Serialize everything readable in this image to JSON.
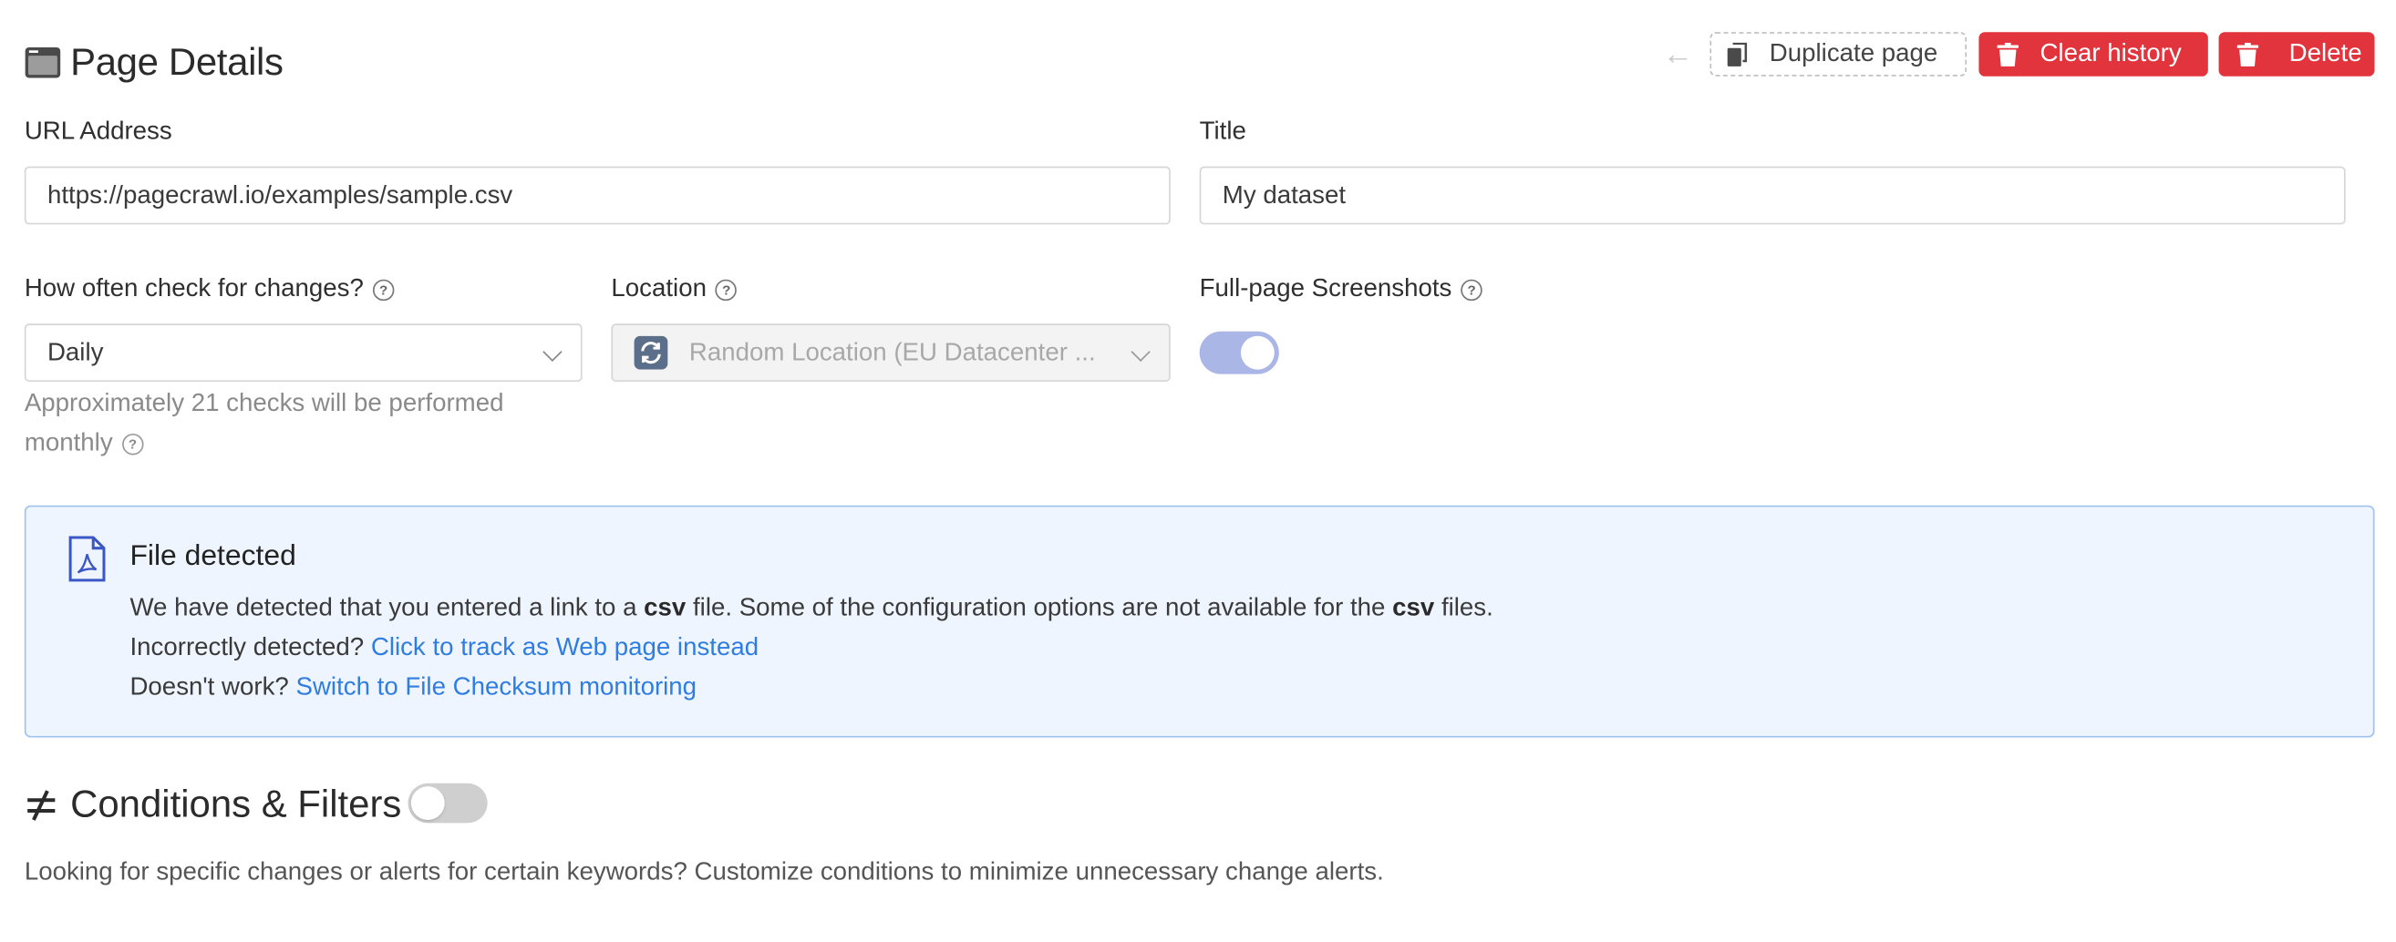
{
  "header": {
    "title": "Page Details",
    "duplicate_label": "Duplicate page",
    "clear_history_label": "Clear history",
    "delete_label": "Delete"
  },
  "fields": {
    "url_label": "URL Address",
    "url_value": "https://pagecrawl.io/examples/sample.csv",
    "title_label": "Title",
    "title_value": "My dataset",
    "frequency_label": "How often check for changes?",
    "frequency_value": "Daily",
    "frequency_hint": "Approximately 21 checks will be performed monthly",
    "location_label": "Location",
    "location_value": "Random Location (EU Datacenter ...",
    "screenshots_label": "Full-page Screenshots",
    "screenshots_enabled": true
  },
  "file_alert": {
    "title": "File detected",
    "line1_a": "We have detected that you entered a link to a ",
    "line1_b": "csv",
    "line1_c": " file. Some of the configuration options are not available for the ",
    "line1_d": "csv",
    "line1_e": " files.",
    "line2_prefix": "Incorrectly detected? ",
    "line2_link": "Click to track as Web page instead",
    "line3_prefix": "Doesn't work? ",
    "line3_link": "Switch to File Checksum monitoring"
  },
  "conditions": {
    "title": "Conditions & Filters",
    "enabled": false,
    "description": "Looking for specific changes or alerts for certain keywords? Customize conditions to minimize unnecessary change alerts."
  },
  "icons": {
    "page_title": "browser-window-icon",
    "back": "arrow-left-icon",
    "duplicate": "copy-icon",
    "clear": "trash-icon",
    "delete": "trash-icon",
    "help": "question-circle-icon",
    "location": "refresh-icon",
    "file": "pdf-file-icon",
    "conditions": "not-equal-icon"
  },
  "colors": {
    "danger": "#e2343d",
    "link": "#2f7de1",
    "alert_bg": "#eef5fe",
    "alert_border": "#9fc2ef",
    "toggle_on": "#a9b6e6"
  }
}
